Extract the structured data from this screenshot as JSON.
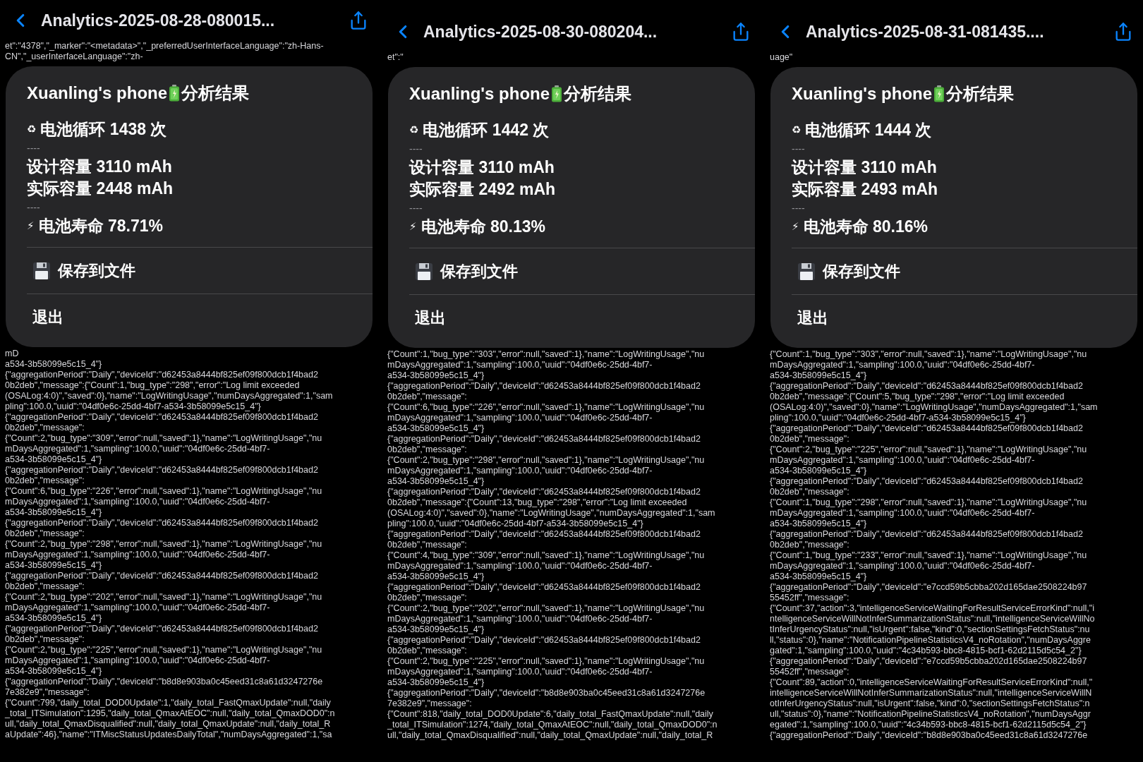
{
  "panels": [
    {
      "title": "Analytics-2025-08-28-080015...",
      "top_lines": [
        "et\":\"4378\",\"_marker\":\"<metadata>\",\"_preferredUserInterfaceLanguage\":\"zh-Hans-",
        "CN\",\"_userInterfaceLanguage\":\"zh-"
      ],
      "card": {
        "device": "Xuanling's phone",
        "heading": "分析结果",
        "rows": [
          {
            "kind": "stat",
            "icon": "♻",
            "text": "电池循环 1438 次"
          },
          {
            "kind": "divider",
            "text": "----"
          },
          {
            "kind": "text",
            "text": "设计容量 3110 mAh"
          },
          {
            "kind": "text",
            "text": "实际容量 2448 mAh"
          },
          {
            "kind": "divider",
            "text": "----"
          },
          {
            "kind": "stat",
            "icon": "⚡",
            "text": "电池寿命 78.71%"
          }
        ],
        "actions": [
          {
            "kind": "save",
            "label": "保存到文件"
          },
          {
            "kind": "exit",
            "label": "退出"
          }
        ]
      },
      "log_lines": [
        "mD",
        "a534-3b58099e5c15_4\"}",
        "{\"aggregationPeriod\":\"Daily\",\"deviceId\":\"d62453a8444bf825ef09f800dcb1f4bad2",
        "0b2deb\",\"message\":{\"Count\":1,\"bug_type\":\"298\",\"error\":\"Log limit exceeded",
        "(OSALog:4:0)\",\"saved\":0},\"name\":\"LogWritingUsage\",\"numDaysAggregated\":1,\"sam",
        "pling\":100.0,\"uuid\":\"04df0e6c-25dd-4bf7-a534-3b58099e5c15_4\"}",
        "{\"aggregationPeriod\":\"Daily\",\"deviceId\":\"d62453a8444bf825ef09f800dcb1f4bad2",
        "0b2deb\",\"message\":",
        "{\"Count\":2,\"bug_type\":\"309\",\"error\":null,\"saved\":1},\"name\":\"LogWritingUsage\",\"nu",
        "mDaysAggregated\":1,\"sampling\":100.0,\"uuid\":\"04df0e6c-25dd-4bf7-",
        "a534-3b58099e5c15_4\"}",
        "{\"aggregationPeriod\":\"Daily\",\"deviceId\":\"d62453a8444bf825ef09f800dcb1f4bad2",
        "0b2deb\",\"message\":",
        "{\"Count\":6,\"bug_type\":\"226\",\"error\":null,\"saved\":1},\"name\":\"LogWritingUsage\",\"nu",
        "mDaysAggregated\":1,\"sampling\":100.0,\"uuid\":\"04df0e6c-25dd-4bf7-",
        "a534-3b58099e5c15_4\"}",
        "{\"aggregationPeriod\":\"Daily\",\"deviceId\":\"d62453a8444bf825ef09f800dcb1f4bad2",
        "0b2deb\",\"message\":",
        "{\"Count\":2,\"bug_type\":\"298\",\"error\":null,\"saved\":1},\"name\":\"LogWritingUsage\",\"nu",
        "mDaysAggregated\":1,\"sampling\":100.0,\"uuid\":\"04df0e6c-25dd-4bf7-",
        "a534-3b58099e5c15_4\"}",
        "{\"aggregationPeriod\":\"Daily\",\"deviceId\":\"d62453a8444bf825ef09f800dcb1f4bad2",
        "0b2deb\",\"message\":",
        "{\"Count\":2,\"bug_type\":\"202\",\"error\":null,\"saved\":1},\"name\":\"LogWritingUsage\",\"nu",
        "mDaysAggregated\":1,\"sampling\":100.0,\"uuid\":\"04df0e6c-25dd-4bf7-",
        "a534-3b58099e5c15_4\"}",
        "{\"aggregationPeriod\":\"Daily\",\"deviceId\":\"d62453a8444bf825ef09f800dcb1f4bad2",
        "0b2deb\",\"message\":",
        "{\"Count\":2,\"bug_type\":\"225\",\"error\":null,\"saved\":1},\"name\":\"LogWritingUsage\",\"nu",
        "mDaysAggregated\":1,\"sampling\":100.0,\"uuid\":\"04df0e6c-25dd-4bf7-",
        "a534-3b58099e5c15_4\"}",
        "{\"aggregationPeriod\":\"Daily\",\"deviceId\":\"b8d8e903ba0c45eed31c8a61d3247276e",
        "7e382e9\",\"message\":",
        "{\"Count\":799,\"daily_total_DOD0Update\":1,\"daily_total_FastQmaxUpdate\":null,\"daily",
        "_total_ITSimulation\":1295,\"daily_total_QmaxAtEOC\":null,\"daily_total_QmaxDOD0\":n",
        "ull,\"daily_total_QmaxDisqualified\":null,\"daily_total_QmaxUpdate\":null,\"daily_total_R",
        "aUpdate\":46},\"name\":\"ITMiscStatusUpdatesDailyTotal\",\"numDaysAggregated\":1,\"sa"
      ]
    },
    {
      "title": "Analytics-2025-08-30-080204...",
      "top_lines": [
        "et\":\""
      ],
      "card": {
        "device": "Xuanling's phone",
        "heading": "分析结果",
        "rows": [
          {
            "kind": "stat",
            "icon": "♻",
            "text": "电池循环 1442 次"
          },
          {
            "kind": "divider",
            "text": "----"
          },
          {
            "kind": "text",
            "text": "设计容量 3110 mAh"
          },
          {
            "kind": "text",
            "text": "实际容量 2492 mAh"
          },
          {
            "kind": "divider",
            "text": "----"
          },
          {
            "kind": "stat",
            "icon": "⚡",
            "text": "电池寿命 80.13%"
          }
        ],
        "actions": [
          {
            "kind": "save",
            "label": "保存到文件"
          },
          {
            "kind": "exit",
            "label": "退出"
          }
        ]
      },
      "log_lines": [
        "{\"Count\":1,\"bug_type\":\"303\",\"error\":null,\"saved\":1},\"name\":\"LogWritingUsage\",\"nu",
        "mDaysAggregated\":1,\"sampling\":100.0,\"uuid\":\"04df0e6c-25dd-4bf7-",
        "a534-3b58099e5c15_4\"}",
        "{\"aggregationPeriod\":\"Daily\",\"deviceId\":\"d62453a8444bf825ef09f800dcb1f4bad2",
        "0b2deb\",\"message\":",
        "{\"Count\":6,\"bug_type\":\"226\",\"error\":null,\"saved\":1},\"name\":\"LogWritingUsage\",\"nu",
        "mDaysAggregated\":1,\"sampling\":100.0,\"uuid\":\"04df0e6c-25dd-4bf7-",
        "a534-3b58099e5c15_4\"}",
        "{\"aggregationPeriod\":\"Daily\",\"deviceId\":\"d62453a8444bf825ef09f800dcb1f4bad2",
        "0b2deb\",\"message\":",
        "{\"Count\":2,\"bug_type\":\"298\",\"error\":null,\"saved\":1},\"name\":\"LogWritingUsage\",\"nu",
        "mDaysAggregated\":1,\"sampling\":100.0,\"uuid\":\"04df0e6c-25dd-4bf7-",
        "a534-3b58099e5c15_4\"}",
        "{\"aggregationPeriod\":\"Daily\",\"deviceId\":\"d62453a8444bf825ef09f800dcb1f4bad2",
        "0b2deb\",\"message\":{\"Count\":13,\"bug_type\":\"298\",\"error\":\"Log limit exceeded",
        "(OSALog:4:0)\",\"saved\":0},\"name\":\"LogWritingUsage\",\"numDaysAggregated\":1,\"sam",
        "pling\":100.0,\"uuid\":\"04df0e6c-25dd-4bf7-a534-3b58099e5c15_4\"}",
        "{\"aggregationPeriod\":\"Daily\",\"deviceId\":\"d62453a8444bf825ef09f800dcb1f4bad2",
        "0b2deb\",\"message\":",
        "{\"Count\":4,\"bug_type\":\"309\",\"error\":null,\"saved\":1},\"name\":\"LogWritingUsage\",\"nu",
        "mDaysAggregated\":1,\"sampling\":100.0,\"uuid\":\"04df0e6c-25dd-4bf7-",
        "a534-3b58099e5c15_4\"}",
        "{\"aggregationPeriod\":\"Daily\",\"deviceId\":\"d62453a8444bf825ef09f800dcb1f4bad2",
        "0b2deb\",\"message\":",
        "{\"Count\":2,\"bug_type\":\"202\",\"error\":null,\"saved\":1},\"name\":\"LogWritingUsage\",\"nu",
        "mDaysAggregated\":1,\"sampling\":100.0,\"uuid\":\"04df0e6c-25dd-4bf7-",
        "a534-3b58099e5c15_4\"}",
        "{\"aggregationPeriod\":\"Daily\",\"deviceId\":\"d62453a8444bf825ef09f800dcb1f4bad2",
        "0b2deb\",\"message\":",
        "{\"Count\":2,\"bug_type\":\"225\",\"error\":null,\"saved\":1},\"name\":\"LogWritingUsage\",\"nu",
        "mDaysAggregated\":1,\"sampling\":100.0,\"uuid\":\"04df0e6c-25dd-4bf7-",
        "a534-3b58099e5c15_4\"}",
        "{\"aggregationPeriod\":\"Daily\",\"deviceId\":\"b8d8e903ba0c45eed31c8a61d3247276e",
        "7e382e9\",\"message\":",
        "{\"Count\":818,\"daily_total_DOD0Update\":6,\"daily_total_FastQmaxUpdate\":null,\"daily",
        "_total_ITSimulation\":1274,\"daily_total_QmaxAtEOC\":null,\"daily_total_QmaxDOD0\":n",
        "ull,\"daily_total_QmaxDisqualified\":null,\"daily_total_QmaxUpdate\":null,\"daily_total_R"
      ]
    },
    {
      "title": "Analytics-2025-08-31-081435....",
      "top_lines": [
        "uage\""
      ],
      "card": {
        "device": "Xuanling's phone",
        "heading": "分析结果",
        "rows": [
          {
            "kind": "stat",
            "icon": "♻",
            "text": "电池循环 1444 次"
          },
          {
            "kind": "divider",
            "text": "----"
          },
          {
            "kind": "text",
            "text": "设计容量 3110 mAh"
          },
          {
            "kind": "text",
            "text": "实际容量 2493 mAh"
          },
          {
            "kind": "divider",
            "text": "----"
          },
          {
            "kind": "stat",
            "icon": "⚡",
            "text": "电池寿命 80.16%"
          }
        ],
        "actions": [
          {
            "kind": "save",
            "label": "保存到文件"
          },
          {
            "kind": "exit",
            "label": "退出"
          }
        ]
      },
      "log_lines": [
        "{\"Count\":1,\"bug_type\":\"303\",\"error\":null,\"saved\":1},\"name\":\"LogWritingUsage\",\"nu",
        "mDaysAggregated\":1,\"sampling\":100.0,\"uuid\":\"04df0e6c-25dd-4bf7-",
        "a534-3b58099e5c15_4\"}",
        "{\"aggregationPeriod\":\"Daily\",\"deviceId\":\"d62453a8444bf825ef09f800dcb1f4bad2",
        "0b2deb\",\"message\":{\"Count\":5,\"bug_type\":\"298\",\"error\":\"Log limit exceeded",
        "(OSALog:4:0)\",\"saved\":0},\"name\":\"LogWritingUsage\",\"numDaysAggregated\":1,\"sam",
        "pling\":100.0,\"uuid\":\"04df0e6c-25dd-4bf7-a534-3b58099e5c15_4\"}",
        "{\"aggregationPeriod\":\"Daily\",\"deviceId\":\"d62453a8444bf825ef09f800dcb1f4bad2",
        "0b2deb\",\"message\":",
        "{\"Count\":2,\"bug_type\":\"225\",\"error\":null,\"saved\":1},\"name\":\"LogWritingUsage\",\"nu",
        "mDaysAggregated\":1,\"sampling\":100.0,\"uuid\":\"04df0e6c-25dd-4bf7-",
        "a534-3b58099e5c15_4\"}",
        "{\"aggregationPeriod\":\"Daily\",\"deviceId\":\"d62453a8444bf825ef09f800dcb1f4bad2",
        "0b2deb\",\"message\":",
        "{\"Count\":1,\"bug_type\":\"298\",\"error\":null,\"saved\":1},\"name\":\"LogWritingUsage\",\"nu",
        "mDaysAggregated\":1,\"sampling\":100.0,\"uuid\":\"04df0e6c-25dd-4bf7-",
        "a534-3b58099e5c15_4\"}",
        "{\"aggregationPeriod\":\"Daily\",\"deviceId\":\"d62453a8444bf825ef09f800dcb1f4bad2",
        "0b2deb\",\"message\":",
        "{\"Count\":1,\"bug_type\":\"233\",\"error\":null,\"saved\":1},\"name\":\"LogWritingUsage\",\"nu",
        "mDaysAggregated\":1,\"sampling\":100.0,\"uuid\":\"04df0e6c-25dd-4bf7-",
        "a534-3b58099e5c15_4\"}",
        "{\"aggregationPeriod\":\"Daily\",\"deviceId\":\"e7ccd59b5cbba202d165dae2508224b97",
        "55452ff\",\"message\":",
        "{\"Count\":37,\"action\":3,\"intelligenceServiceWaitingForResultServiceErrorKind\":null,\"i",
        "ntelligenceServiceWillNotInferSummarizationStatus\":null,\"intelligenceServiceWillNo",
        "tInferUrgencyStatus\":null,\"isUrgent\":false,\"kind\":0,\"sectionSettingsFetchStatus\":nu",
        "ll,\"status\":0},\"name\":\"NotificationPipelineStatisticsV4_noRotation\",\"numDaysAggre",
        "gated\":1,\"sampling\":100.0,\"uuid\":\"4c34b593-bbc8-4815-bcf1-62d2115d5c54_2\"}",
        "{\"aggregationPeriod\":\"Daily\",\"deviceId\":\"e7ccd59b5cbba202d165dae2508224b97",
        "55452ff\",\"message\":",
        "{\"Count\":89,\"action\":0,\"intelligenceServiceWaitingForResultServiceErrorKind\":null,\"",
        "intelligenceServiceWillNotInferSummarizationStatus\":null,\"intelligenceServiceWillN",
        "otInferUrgencyStatus\":null,\"isUrgent\":false,\"kind\":0,\"sectionSettingsFetchStatus\":n",
        "ull,\"status\":0},\"name\":\"NotificationPipelineStatisticsV4_noRotation\",\"numDaysAggr",
        "egated\":1,\"sampling\":100.0,\"uuid\":\"4c34b593-bbc8-4815-bcf1-62d2115d5c54_2\"}",
        "{\"aggregationPeriod\":\"Daily\",\"deviceId\":\"b8d8e903ba0c45eed31c8a61d3247276e"
      ]
    }
  ]
}
